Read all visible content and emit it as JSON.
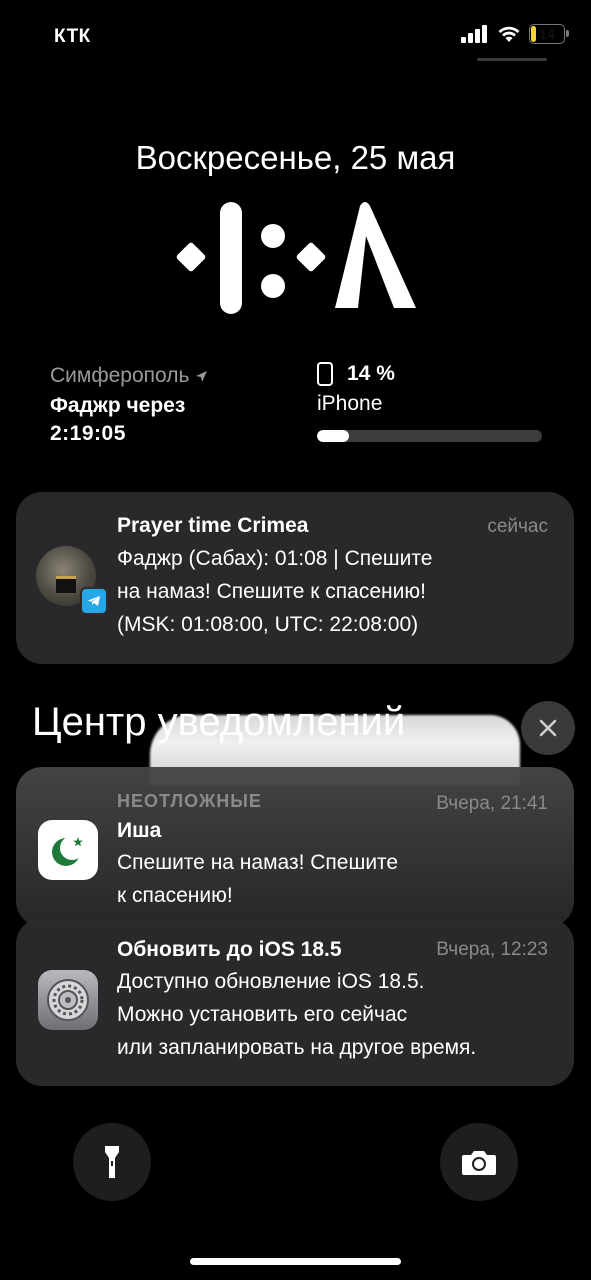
{
  "status_bar": {
    "carrier": "КТК",
    "battery_level": "14",
    "battery_fraction": 0.14,
    "battery_color": "#f4d33a"
  },
  "lock": {
    "date": "Воскресенье, 25 мая"
  },
  "widgets": {
    "prayer": {
      "city": "Симферополь",
      "label": "Фаджр через",
      "time": "2:19:05"
    },
    "battery": {
      "percent_text": "14 %",
      "device": "iPhone",
      "level": 0.14
    }
  },
  "notifications": {
    "telegram": {
      "app": "Prayer time Crimea",
      "time": "сейчас",
      "lines": [
        "Фаджр (Сабах): 01:08 | Спешите",
        "на намаз! Спешите к спасению!",
        "(MSK: 01:08:00, UTC: 22:08:00)"
      ]
    },
    "center_title": "Центр уведомлений",
    "isha": {
      "tag": "НЕОТЛОЖНЫЕ",
      "time": "Вчера, 21:41",
      "title": "Иша",
      "lines": [
        "Спешите на намаз! Спешите",
        "к спасению!"
      ]
    },
    "update": {
      "title": "Обновить до iOS 18.5",
      "time": "Вчера, 12:23",
      "lines": [
        "Доступно обновление iOS 18.5.",
        "Можно установить его сейчас",
        "или запланировать на другое время."
      ]
    }
  },
  "colors": {
    "telegram_blue": "#27a7e7",
    "islam_green": "#1f7a3a"
  }
}
